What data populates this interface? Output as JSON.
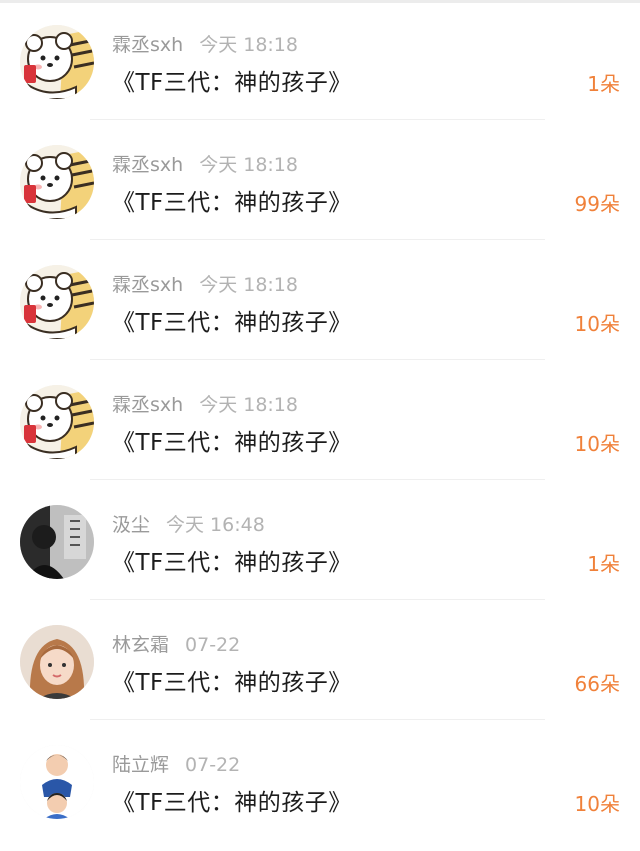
{
  "gift_list": [
    {
      "user": "霖丞sxh",
      "time": "今天 18:18",
      "title": "《TF三代：神的孩子》",
      "amount": "1朵",
      "avatar": "bear-sticker-avatar"
    },
    {
      "user": "霖丞sxh",
      "time": "今天 18:18",
      "title": "《TF三代：神的孩子》",
      "amount": "99朵",
      "avatar": "bear-sticker-avatar"
    },
    {
      "user": "霖丞sxh",
      "time": "今天 18:18",
      "title": "《TF三代：神的孩子》",
      "amount": "10朵",
      "avatar": "bear-sticker-avatar"
    },
    {
      "user": "霖丞sxh",
      "time": "今天 18:18",
      "title": "《TF三代：神的孩子》",
      "amount": "10朵",
      "avatar": "bear-sticker-avatar"
    },
    {
      "user": "汲尘",
      "time": "今天 16:48",
      "title": "《TF三代：神的孩子》",
      "amount": "1朵",
      "avatar": "dark-portrait-avatar"
    },
    {
      "user": "林玄霜",
      "time": "07-22",
      "title": "《TF三代：神的孩子》",
      "amount": "66朵",
      "avatar": "girl-portrait-avatar"
    },
    {
      "user": "陆立辉",
      "time": "07-22",
      "title": "《TF三代：神的孩子》",
      "amount": "10朵",
      "avatar": "cartoon-kids-avatar"
    }
  ],
  "colors": {
    "amount": "#f0813a",
    "username": "#9a9a9a",
    "title": "#1c1c1c"
  }
}
